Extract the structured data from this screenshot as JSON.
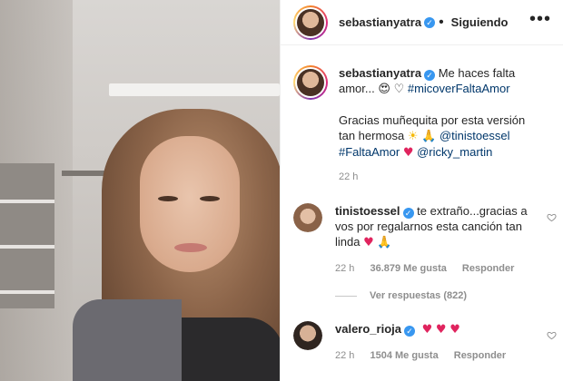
{
  "header": {
    "username": "sebastianyatra",
    "separator": "•",
    "follow_status": "Siguiendo",
    "more_icon": "more-horizontal-icon"
  },
  "caption": {
    "username": "sebastianyatra",
    "line1": "Me haces falta amor...",
    "hashtag1": "#micoverFaltaAmor",
    "line2": "Gracias muñequita por esta versión tan hermosa",
    "mention1": "@tinistoessel",
    "hashtag2": "#FaltaAmor",
    "mention2": "@ricky_martin",
    "time": "22 h"
  },
  "comments": [
    {
      "username": "tinistoessel",
      "text": "te extraño...gracias a vos por regalarnos esta canción tan linda",
      "time": "22 h",
      "likes": "36.879 Me gusta",
      "reply": "Responder"
    },
    {
      "username": "valero_rioja",
      "time": "22 h",
      "likes": "1504 Me gusta",
      "reply": "Responder"
    }
  ],
  "replies": {
    "label": "Ver respuestas (822)"
  },
  "colors": {
    "verified": "#3897f0",
    "link": "#00376b",
    "muted": "#8e8e8e",
    "heart": "#e0245e"
  }
}
